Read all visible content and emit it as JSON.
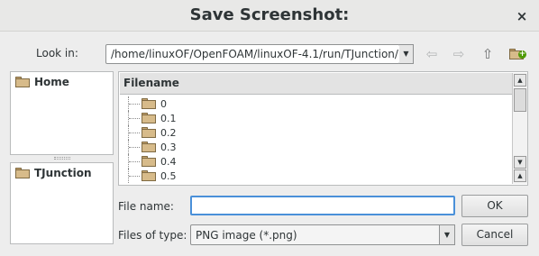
{
  "window": {
    "title": "Save Screenshot:",
    "close_glyph": "×"
  },
  "look_in": {
    "label": "Look in:",
    "path": "/home/linuxOF/OpenFOAM/linuxOF-4.1/run/TJunction/",
    "dropdown_glyph": "▼"
  },
  "nav_icons": [
    {
      "name": "back-icon",
      "glyph": "⇦"
    },
    {
      "name": "forward-icon",
      "glyph": "⇨"
    },
    {
      "name": "parent-dir-icon",
      "glyph": "⇧"
    },
    {
      "name": "new-folder-icon",
      "glyph": "+"
    }
  ],
  "sidebar": {
    "items": [
      {
        "label": "Home"
      },
      {
        "label": "TJunction"
      }
    ]
  },
  "file_list": {
    "header": "Filename",
    "rows": [
      "0",
      "0.1",
      "0.2",
      "0.3",
      "0.4",
      "0.5"
    ]
  },
  "file_name": {
    "label": "File name:",
    "value": ""
  },
  "file_type": {
    "label": "Files of type:",
    "value": "PNG image (*.png)",
    "dropdown_glyph": "▼"
  },
  "buttons": {
    "ok": "OK",
    "cancel": "Cancel"
  },
  "scroll": {
    "up_glyph": "▲",
    "down_glyph": "▼"
  }
}
